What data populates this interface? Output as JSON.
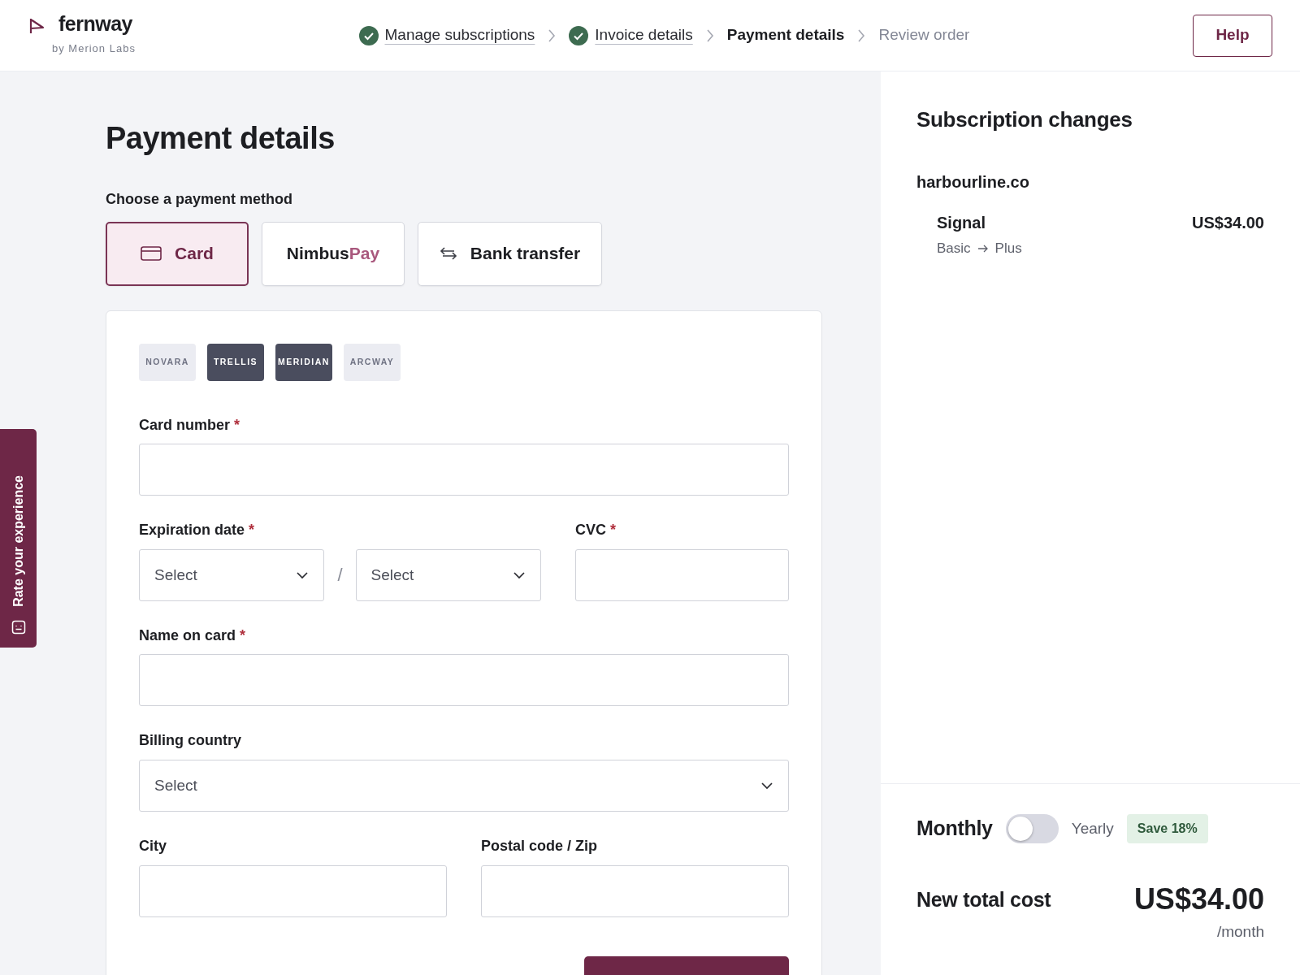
{
  "brand": {
    "name": "fernway",
    "tagline": "by Merion Labs"
  },
  "steps": [
    {
      "label": "Manage subscriptions",
      "completed": true,
      "selected": false
    },
    {
      "label": "Invoice details",
      "completed": true,
      "selected": false
    },
    {
      "label": "Payment details",
      "completed": false,
      "selected": true
    },
    {
      "label": "Review order",
      "completed": false,
      "selected": false
    }
  ],
  "help_button": "Help",
  "feedback_tab": "Rate your experience",
  "page_title": "Payment details",
  "method_prompt": "Choose a payment method",
  "methods": [
    {
      "kind": "card",
      "label": "Card",
      "selected": true
    },
    {
      "kind": "wallet",
      "label": "Nimbus",
      "label_accent": "Pay",
      "selected": false
    },
    {
      "kind": "bank",
      "label": "Bank transfer",
      "selected": false
    }
  ],
  "card_brands": [
    {
      "label": "NOVARA",
      "dark": false
    },
    {
      "label": "TRELLIS",
      "dark": true
    },
    {
      "label": "MERIDIAN",
      "dark": true
    },
    {
      "label": "ARCWAY",
      "dark": false
    }
  ],
  "required_mark": "*",
  "form_rows": [
    {
      "fields": [
        {
          "label": "Card number",
          "required": true,
          "inputs": [
            {
              "kind": "text"
            }
          ]
        }
      ]
    },
    {
      "fields": [
        {
          "label": "Expiration date",
          "required": true,
          "separator": "/",
          "inputs": [
            {
              "kind": "select",
              "placeholder": "Select"
            },
            {
              "kind": "select",
              "placeholder": "Select"
            }
          ]
        },
        {
          "label": "CVC",
          "required": true,
          "inputs": [
            {
              "kind": "text"
            }
          ]
        }
      ]
    },
    {
      "fields": [
        {
          "label": "Name on card",
          "required": true,
          "inputs": [
            {
              "kind": "text"
            }
          ]
        }
      ]
    },
    {
      "fields": [
        {
          "label": "Billing country",
          "required": false,
          "inputs": [
            {
              "kind": "select",
              "placeholder": "Select"
            }
          ]
        }
      ]
    },
    {
      "fields": [
        {
          "label": "City",
          "required": false,
          "inputs": [
            {
              "kind": "text"
            }
          ]
        },
        {
          "label": "Postal code / Zip",
          "required": false,
          "inputs": [
            {
              "kind": "text"
            }
          ]
        }
      ]
    }
  ],
  "summary": {
    "title": "Subscription changes",
    "account": "harbourline.co",
    "items": [
      {
        "product": "Signal",
        "from": "Basic",
        "to": "Plus",
        "price": "US$34.00"
      }
    ],
    "billing": {
      "monthly_label": "Monthly",
      "yearly_label": "Yearly",
      "yearly": false,
      "save_badge": "Save 18%"
    },
    "total_label": "New total cost",
    "total": "US$34.00",
    "period": "/month"
  }
}
